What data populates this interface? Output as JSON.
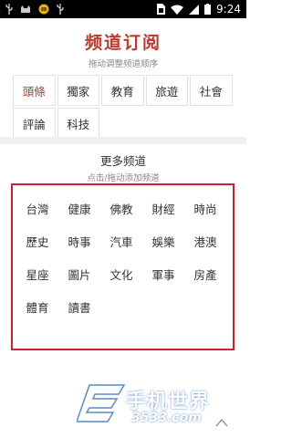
{
  "statusbar": {
    "time": "9:24",
    "left_icons": [
      "usb-icon",
      "cat-icon",
      "battery-app-icon",
      "usb-icon"
    ],
    "right_icons": [
      "sim-icon",
      "wifi-icon",
      "signal-icon",
      "battery-icon"
    ]
  },
  "subscribed": {
    "title": "频道订阅",
    "hint": "拖动调整频道顺序",
    "items": [
      {
        "label": "頭條",
        "active": true
      },
      {
        "label": "獨家"
      },
      {
        "label": "教育"
      },
      {
        "label": "旅遊"
      },
      {
        "label": "社會"
      },
      {
        "label": "評論"
      },
      {
        "label": "科技"
      }
    ]
  },
  "more": {
    "title": "更多频道",
    "hint": "点击/拖动添加频道",
    "items": [
      {
        "label": "台灣"
      },
      {
        "label": "健康"
      },
      {
        "label": "佛教"
      },
      {
        "label": "財經"
      },
      {
        "label": "時尚"
      },
      {
        "label": "歷史"
      },
      {
        "label": "時事"
      },
      {
        "label": "汽車"
      },
      {
        "label": "娛樂"
      },
      {
        "label": "港澳"
      },
      {
        "label": "星座"
      },
      {
        "label": "圖片"
      },
      {
        "label": "文化"
      },
      {
        "label": "軍事"
      },
      {
        "label": "房產"
      },
      {
        "label": "體育"
      },
      {
        "label": "讀書"
      }
    ]
  },
  "watermark": {
    "brand": "手机世界",
    "site": "3533.com"
  },
  "colors": {
    "accent": "#c0392b",
    "highlight_box": "#d22030",
    "watermark": "#4a7fbf"
  }
}
